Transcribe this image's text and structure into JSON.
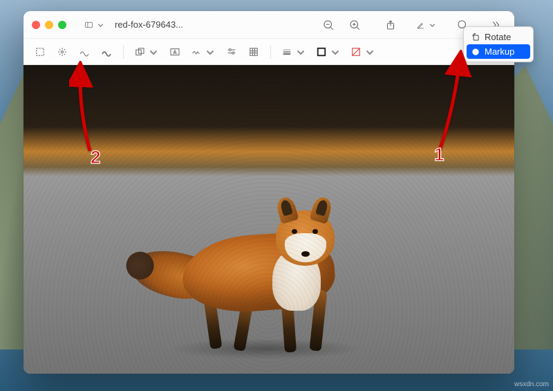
{
  "window": {
    "filename": "red-fox-679643..."
  },
  "titlebar": {
    "sidebar_icon": "sidebar-icon",
    "zoom_out_icon": "zoom-out-icon",
    "zoom_in_icon": "zoom-in-icon",
    "share_icon": "share-icon",
    "highlight_icon": "highlight-icon",
    "search_icon": "search-icon",
    "overflow_icon": "chevrons-icon"
  },
  "popover": {
    "rotate_label": "Rotate",
    "markup_label": "Markup"
  },
  "markup": {
    "tools": {
      "selection": "selection-icon",
      "instant_alpha": "instant-alpha-icon",
      "sketch": "sketch-icon",
      "draw": "draw-icon",
      "shapes": "shapes-icon",
      "text": "text-icon",
      "sign": "sign-icon",
      "adjust_color": "adjust-color-icon",
      "crop": "crop-icon",
      "line_style": "line-style-icon",
      "border_color": "border-color-icon",
      "fill_color": "fill-color-icon",
      "font_style": "font-style-icon"
    }
  },
  "annotations": {
    "num1": "1",
    "num2": "2",
    "arrow_color": "#d00000"
  },
  "watermark": "wsxdn.com"
}
